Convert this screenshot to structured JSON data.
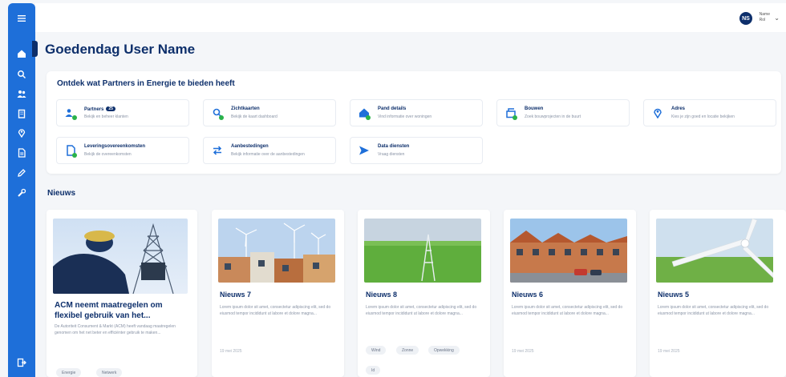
{
  "sidebar": {
    "icons": [
      "menu-icon",
      "home-icon",
      "search-icon",
      "people-icon",
      "building-icon",
      "pin-icon",
      "document-icon",
      "edit-icon",
      "tools-icon",
      "logout-icon"
    ]
  },
  "topbar": {
    "avatar_initials": "NS",
    "user_name": "Name",
    "user_role": "Rol"
  },
  "greeting": "Goedendag User Name",
  "explore": {
    "title": "Ontdek wat Partners in Energie te bieden heeft",
    "tiles": [
      {
        "title": "Partners",
        "badge": "25",
        "subtitle": "Bekijk en beheer klanten"
      },
      {
        "title": "Zichtkaarten",
        "subtitle": "Bekijk de kaart dashboard"
      },
      {
        "title": "Pand details",
        "subtitle": "Vind informatie over woningen"
      },
      {
        "title": "Bouwen",
        "subtitle": "Zoek bouwprojecten in de buurt"
      },
      {
        "title": "Adres",
        "subtitle": "Kies je zijn goed en locatie bekijken"
      },
      {
        "title": "Leveringsovereenkomsten",
        "subtitle": "Bekijk de overeenkomsten"
      },
      {
        "title": "Aanbestedingen",
        "subtitle": "Bekijk informatie over de aanbestedingen"
      },
      {
        "title": "Data diensten",
        "subtitle": "Vraag diensten"
      }
    ]
  },
  "news": {
    "heading": "Nieuws",
    "items": [
      {
        "title": "ACM neemt maatregelen om flexibel gebruik van het...",
        "excerpt": "De Autoriteit Consument & Markt (ACM) heeft vandaag maatregelen genomen om het net beter en efficiënter gebruik te maken...",
        "tags": [
          "Energie",
          "Netwerk"
        ]
      },
      {
        "title": "Nieuws 7",
        "excerpt": "Lorem ipsum dolor sit amet, consectetur adipiscing elit, sed do eiusmod tempor incididunt ut labore et dolore magna...",
        "date": "19 mei 2025",
        "tags": []
      },
      {
        "title": "Nieuws 8",
        "excerpt": "Lorem ipsum dolor sit amet, consectetur adipiscing elit, sed do eiusmod tempor incididunt ut labore et dolore magna...",
        "tags": [
          "Wind",
          "Zonne",
          "Opwekking",
          "Id"
        ]
      },
      {
        "title": "Nieuws 6",
        "excerpt": "Lorem ipsum dolor sit amet, consectetur adipiscing elit, sed do eiusmod tempor incididunt ut labore et dolore magna...",
        "date": "19 mei 2025",
        "tags": []
      },
      {
        "title": "Nieuws 5",
        "excerpt": "Lorem ipsum dolor sit amet, consectetur adipiscing elit, sed do eiusmod tempor incididunt ut labore et dolore magna...",
        "date": "19 mei 2025",
        "tags": []
      }
    ]
  },
  "colors": {
    "sidebar": "#1e6fd9",
    "navy": "#0d2f6b",
    "accent_green": "#2ab24a"
  }
}
